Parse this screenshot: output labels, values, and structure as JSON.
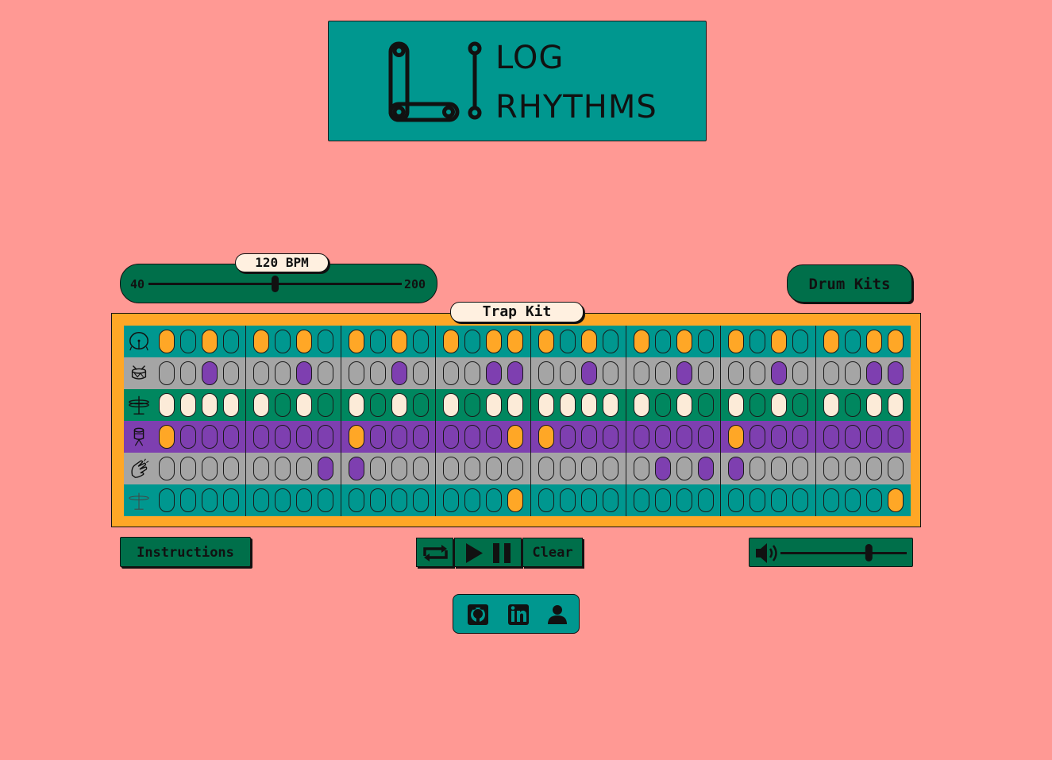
{
  "header": {
    "logo_line1": "LOG",
    "logo_line2": "RHYTHMS"
  },
  "tempo": {
    "label": "120 BPM",
    "min_label": "40",
    "max_label": "200",
    "min": 40,
    "max": 200,
    "value": 120
  },
  "drum_kits_button": "Drum Kits",
  "kit_name": "Trap Kit",
  "rows": [
    {
      "icon": "bass-drum-icon",
      "bg": "#00978f",
      "on": "#ffa726",
      "off": "#00978f",
      "steps": [
        1,
        0,
        1,
        0,
        1,
        0,
        1,
        0,
        1,
        0,
        1,
        0,
        1,
        0,
        1,
        1,
        1,
        0,
        1,
        0,
        1,
        0,
        1,
        0,
        1,
        0,
        1,
        0,
        1,
        0,
        1,
        1
      ]
    },
    {
      "icon": "snare-drum-icon",
      "bg": "#a5a5a5",
      "on": "#7e3fb0",
      "off": "#a5a5a5",
      "steps": [
        0,
        0,
        1,
        0,
        0,
        0,
        1,
        0,
        0,
        0,
        1,
        0,
        0,
        0,
        1,
        1,
        0,
        0,
        1,
        0,
        0,
        0,
        1,
        0,
        0,
        0,
        1,
        0,
        0,
        0,
        1,
        1
      ]
    },
    {
      "icon": "hi-hat-icon",
      "bg": "#00875f",
      "on": "#fcebd8",
      "off": "#00875f",
      "steps": [
        1,
        1,
        1,
        1,
        1,
        0,
        1,
        0,
        1,
        0,
        1,
        0,
        1,
        0,
        1,
        1,
        1,
        1,
        1,
        1,
        1,
        0,
        1,
        0,
        1,
        0,
        1,
        0,
        1,
        0,
        1,
        1
      ]
    },
    {
      "icon": "tom-drum-icon",
      "bg": "#7e3fb0",
      "on": "#ffa726",
      "off": "#7e3fb0",
      "steps": [
        1,
        0,
        0,
        0,
        0,
        0,
        0,
        0,
        1,
        0,
        0,
        0,
        0,
        0,
        0,
        1,
        1,
        0,
        0,
        0,
        0,
        0,
        0,
        0,
        1,
        0,
        0,
        0,
        0,
        0,
        0,
        0
      ]
    },
    {
      "icon": "clap-icon",
      "bg": "#a5a5a5",
      "on": "#7e3fb0",
      "off": "#a5a5a5",
      "steps": [
        0,
        0,
        0,
        0,
        0,
        0,
        0,
        1,
        1,
        0,
        0,
        0,
        0,
        0,
        0,
        0,
        0,
        0,
        0,
        0,
        0,
        1,
        0,
        1,
        1,
        0,
        0,
        0,
        0,
        0,
        0,
        0
      ]
    },
    {
      "icon": "crash-cymbal-icon",
      "bg": "#00978f",
      "on": "#ffa726",
      "off": "#00978f",
      "steps": [
        0,
        0,
        0,
        0,
        0,
        0,
        0,
        0,
        0,
        0,
        0,
        0,
        0,
        0,
        0,
        1,
        0,
        0,
        0,
        0,
        0,
        0,
        0,
        0,
        0,
        0,
        0,
        0,
        0,
        0,
        0,
        1
      ]
    }
  ],
  "controls": {
    "instructions": "Instructions",
    "clear": "Clear",
    "loop_icon": "loop-icon",
    "play_icon": "play-icon",
    "pause_icon": "pause-icon"
  },
  "volume": {
    "icon": "speaker-icon",
    "value": 0.7
  },
  "social": [
    "github-icon",
    "linkedin-icon",
    "person-icon"
  ]
}
